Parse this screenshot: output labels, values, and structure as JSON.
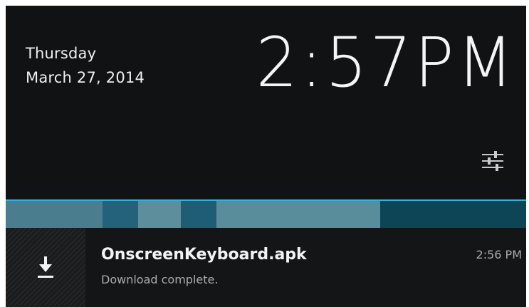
{
  "status": {
    "day": "Thursday",
    "date": "March 27, 2014",
    "time": "2:57PM"
  },
  "quick_settings": {
    "icon": "settings-sliders-icon"
  },
  "notification": {
    "icon": "download-icon",
    "title": "OnscreenKeyboard.apk",
    "subtitle": "Download complete.",
    "time": "2:56 PM"
  },
  "colors": {
    "background": "#111213",
    "accent": "#35b1d9",
    "text_primary": "#f2f4f4",
    "text_secondary": "#a9abad"
  }
}
